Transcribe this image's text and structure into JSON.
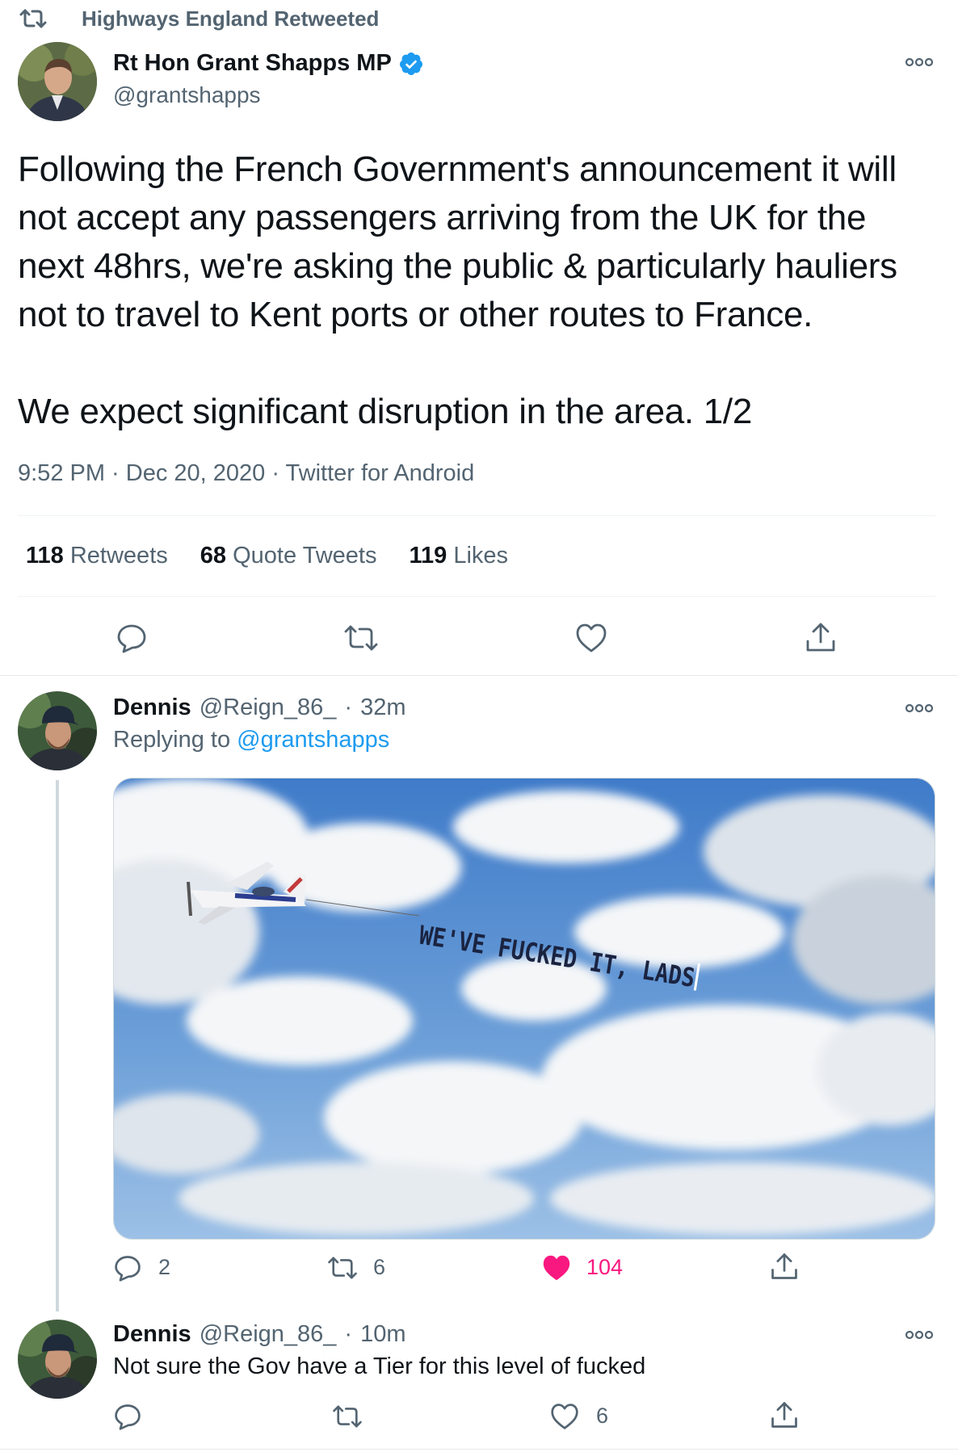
{
  "retweet_banner": {
    "icon": "retweet-icon",
    "label": "Highways England Retweeted"
  },
  "main_tweet": {
    "author_name": "Rt Hon Grant Shapps MP",
    "handle": "@grantshapps",
    "verified_icon": "verified-badge-icon",
    "text_paragraph_1_lines": [
      "Following the French Government's announcement it will",
      "not accept any passengers arriving from the UK for the",
      "next 48hrs, we're asking the public & particularly hauliers",
      "not to travel to Kent ports or other routes to France."
    ],
    "text_paragraph_2": "We expect significant disruption in the area. 1/2",
    "timestamp": "9:52 PM · Dec 20, 2020 · Twitter for Android",
    "stats": {
      "retweets_count": "118",
      "retweets_label": "Retweets",
      "quotes_count": "68",
      "quotes_label": "Quote Tweets",
      "likes_count": "119",
      "likes_label": "Likes"
    }
  },
  "reply_1": {
    "author_name": "Dennis",
    "handle": "@Reign_86_",
    "dot": "·",
    "time": "32m",
    "replying_to_prefix": "Replying to",
    "replying_to_handle": "@grantshapps",
    "image_banner_text": "WE'VE FUCKED IT, LADS",
    "reply_count": "2",
    "retweet_count": "6",
    "like_count": "104",
    "liked": true
  },
  "reply_2": {
    "author_name": "Dennis",
    "handle": "@Reign_86_",
    "dot": "·",
    "time": "10m",
    "text": "Not sure the Gov have a Tier for this level of fucked",
    "reply_count": "",
    "retweet_count": "",
    "like_count": "6"
  },
  "colors": {
    "accent": "#1d9bf0",
    "like_red": "#f91880",
    "muted": "#536471"
  }
}
